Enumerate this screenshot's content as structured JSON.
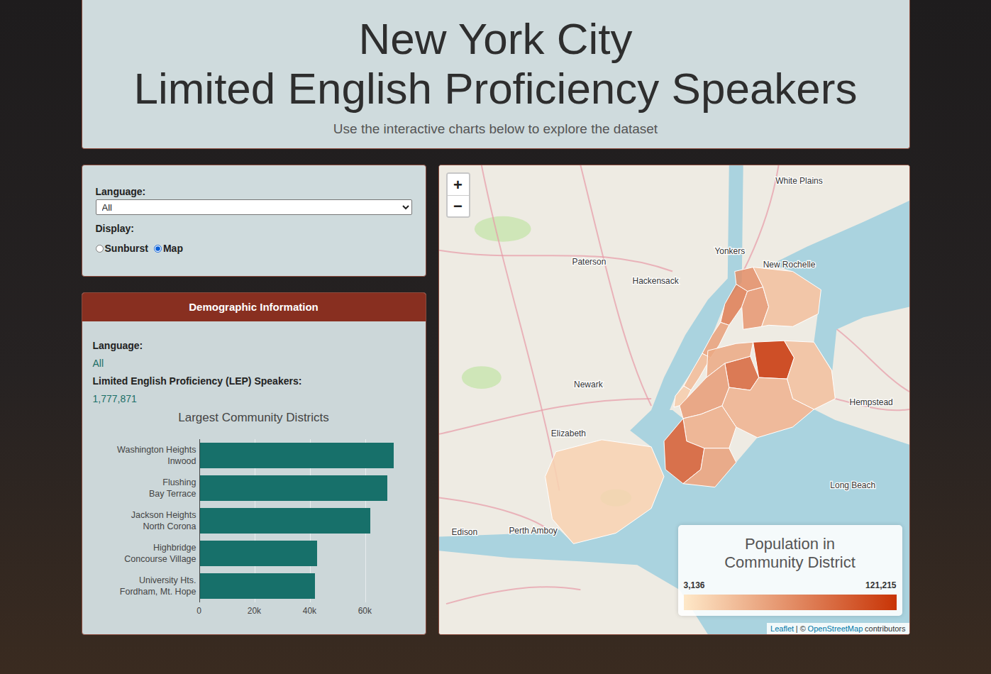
{
  "header": {
    "title_lines": [
      "New York City",
      "Limited English Proficiency Speakers"
    ],
    "subtitle": "Use the interactive charts below to explore the dataset"
  },
  "controls": {
    "language_label": "Language:",
    "language_value": "All",
    "display_label": "Display:",
    "display_options": [
      {
        "label": "Sunburst",
        "selected": false
      },
      {
        "label": "Map",
        "selected": true
      }
    ]
  },
  "demographics": {
    "title": "Demographic Information",
    "language_label": "Language:",
    "language_value": "All",
    "lep_label": "Limited English Proficiency (LEP) Speakers:",
    "lep_value": "1,777,871",
    "chart": {
      "title": "Largest Community Districts",
      "categories": [
        [
          "Washington Heights",
          "Inwood"
        ],
        [
          "Flushing",
          "Bay Terrace"
        ],
        [
          "Jackson Heights",
          "North Corona"
        ],
        [
          "Highbridge",
          "Concourse Village"
        ],
        [
          "University Hts.",
          "Fordham, Mt. Hope"
        ]
      ],
      "series": [
        {
          "values": [
            70500,
            68000,
            61800,
            42600,
            41800
          ]
        }
      ],
      "ticks": [
        "0",
        "20k",
        "40k",
        "60k"
      ],
      "tick_values": [
        0,
        20000,
        40000,
        60000
      ]
    }
  },
  "map": {
    "zoom_in": "+",
    "zoom_out": "−",
    "legend": {
      "title_lines": [
        "Population in",
        "Community District"
      ],
      "min": "3,136",
      "max": "121,215"
    },
    "attribution": [
      {
        "text": "Leaflet",
        "link": true
      },
      {
        "text": "| ©",
        "link": false
      },
      {
        "text": "OpenStreetMap",
        "link": true
      },
      {
        "text": "contributors",
        "link": false
      }
    ],
    "places": [
      "White Plains",
      "Yonkers",
      "New Rochelle",
      "Paterson",
      "Hackensack",
      "Newark",
      "Elizabeth",
      "Hempstead",
      "Long Beach",
      "Perth Amboy",
      "Edison"
    ],
    "districts": [
      {
        "level": 0.6
      },
      {
        "level": 0.4
      },
      {
        "level": 0.25
      },
      {
        "level": 0.15
      },
      {
        "level": 0.45
      },
      {
        "level": 0.5
      },
      {
        "level": 0.22
      },
      {
        "level": 1.0
      },
      {
        "level": 0.72
      },
      {
        "level": 0.35
      },
      {
        "level": 0.22
      },
      {
        "level": 0.3
      },
      {
        "level": 0.42
      },
      {
        "level": 0.32
      },
      {
        "level": 0.78
      },
      {
        "level": 0.4
      },
      {
        "level": 0.12
      }
    ]
  }
}
